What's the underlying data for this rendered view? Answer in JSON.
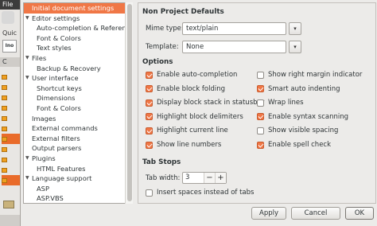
{
  "background": {
    "menu_label": "File",
    "quick_label": "Quic",
    "icon_label": "Ino",
    "tab_label": "C"
  },
  "tree": {
    "items": [
      {
        "label": "Initial document settings",
        "level": 0,
        "arrow": "",
        "selected": true
      },
      {
        "label": "Editor settings",
        "level": 0,
        "arrow": "▼",
        "selected": false
      },
      {
        "label": "Auto-completion & Reference",
        "level": 1,
        "arrow": "",
        "selected": false
      },
      {
        "label": "Font & Colors",
        "level": 1,
        "arrow": "",
        "selected": false
      },
      {
        "label": "Text styles",
        "level": 1,
        "arrow": "",
        "selected": false
      },
      {
        "label": "Files",
        "level": 0,
        "arrow": "▼",
        "selected": false
      },
      {
        "label": "Backup & Recovery",
        "level": 1,
        "arrow": "",
        "selected": false
      },
      {
        "label": "User interface",
        "level": 0,
        "arrow": "▼",
        "selected": false
      },
      {
        "label": "Shortcut keys",
        "level": 1,
        "arrow": "",
        "selected": false
      },
      {
        "label": "Dimensions",
        "level": 1,
        "arrow": "",
        "selected": false
      },
      {
        "label": "Font & Colors",
        "level": 1,
        "arrow": "",
        "selected": false
      },
      {
        "label": "Images",
        "level": 0,
        "arrow": "",
        "selected": false
      },
      {
        "label": "External commands",
        "level": 0,
        "arrow": "",
        "selected": false
      },
      {
        "label": "External filters",
        "level": 0,
        "arrow": "",
        "selected": false
      },
      {
        "label": "Output parsers",
        "level": 0,
        "arrow": "",
        "selected": false
      },
      {
        "label": "Plugins",
        "level": 0,
        "arrow": "▼",
        "selected": false
      },
      {
        "label": "HTML Features",
        "level": 1,
        "arrow": "",
        "selected": false
      },
      {
        "label": "Language support",
        "level": 0,
        "arrow": "▼",
        "selected": false
      },
      {
        "label": "ASP",
        "level": 1,
        "arrow": "",
        "selected": false
      },
      {
        "label": "ASP.VBS",
        "level": 1,
        "arrow": "",
        "selected": false
      }
    ]
  },
  "defaults": {
    "title": "Non Project Defaults",
    "mime_label": "Mime type:",
    "mime_value": "text/plain",
    "template_label": "Template:",
    "template_value": "None"
  },
  "options": {
    "title": "Options",
    "left": [
      {
        "label": "Enable auto-completion",
        "checked": true
      },
      {
        "label": "Enable block folding",
        "checked": true
      },
      {
        "label": "Display block stack in statusbar",
        "checked": true
      },
      {
        "label": "Highlight block delimiters",
        "checked": true
      },
      {
        "label": "Highlight current line",
        "checked": true
      },
      {
        "label": "Show line numbers",
        "checked": true
      }
    ],
    "right": [
      {
        "label": "Show right margin indicator",
        "checked": false
      },
      {
        "label": "Smart auto indenting",
        "checked": true
      },
      {
        "label": "Wrap lines",
        "checked": false
      },
      {
        "label": "Enable syntax scanning",
        "checked": true
      },
      {
        "label": "Show visible spacing",
        "checked": false
      },
      {
        "label": "Enable spell check",
        "checked": true
      }
    ]
  },
  "tabstops": {
    "title": "Tab Stops",
    "width_label": "Tab width:",
    "width_value": "3",
    "minus": "−",
    "plus": "+",
    "spaces_label": "Insert spaces instead of tabs",
    "spaces_checked": false
  },
  "buttons": {
    "apply": "Apply",
    "cancel": "Cancel",
    "ok": "OK"
  },
  "icons": {
    "combo_arrow": "▾",
    "expand_arrow": "▼"
  },
  "colors": {
    "accent": "#f07746"
  }
}
